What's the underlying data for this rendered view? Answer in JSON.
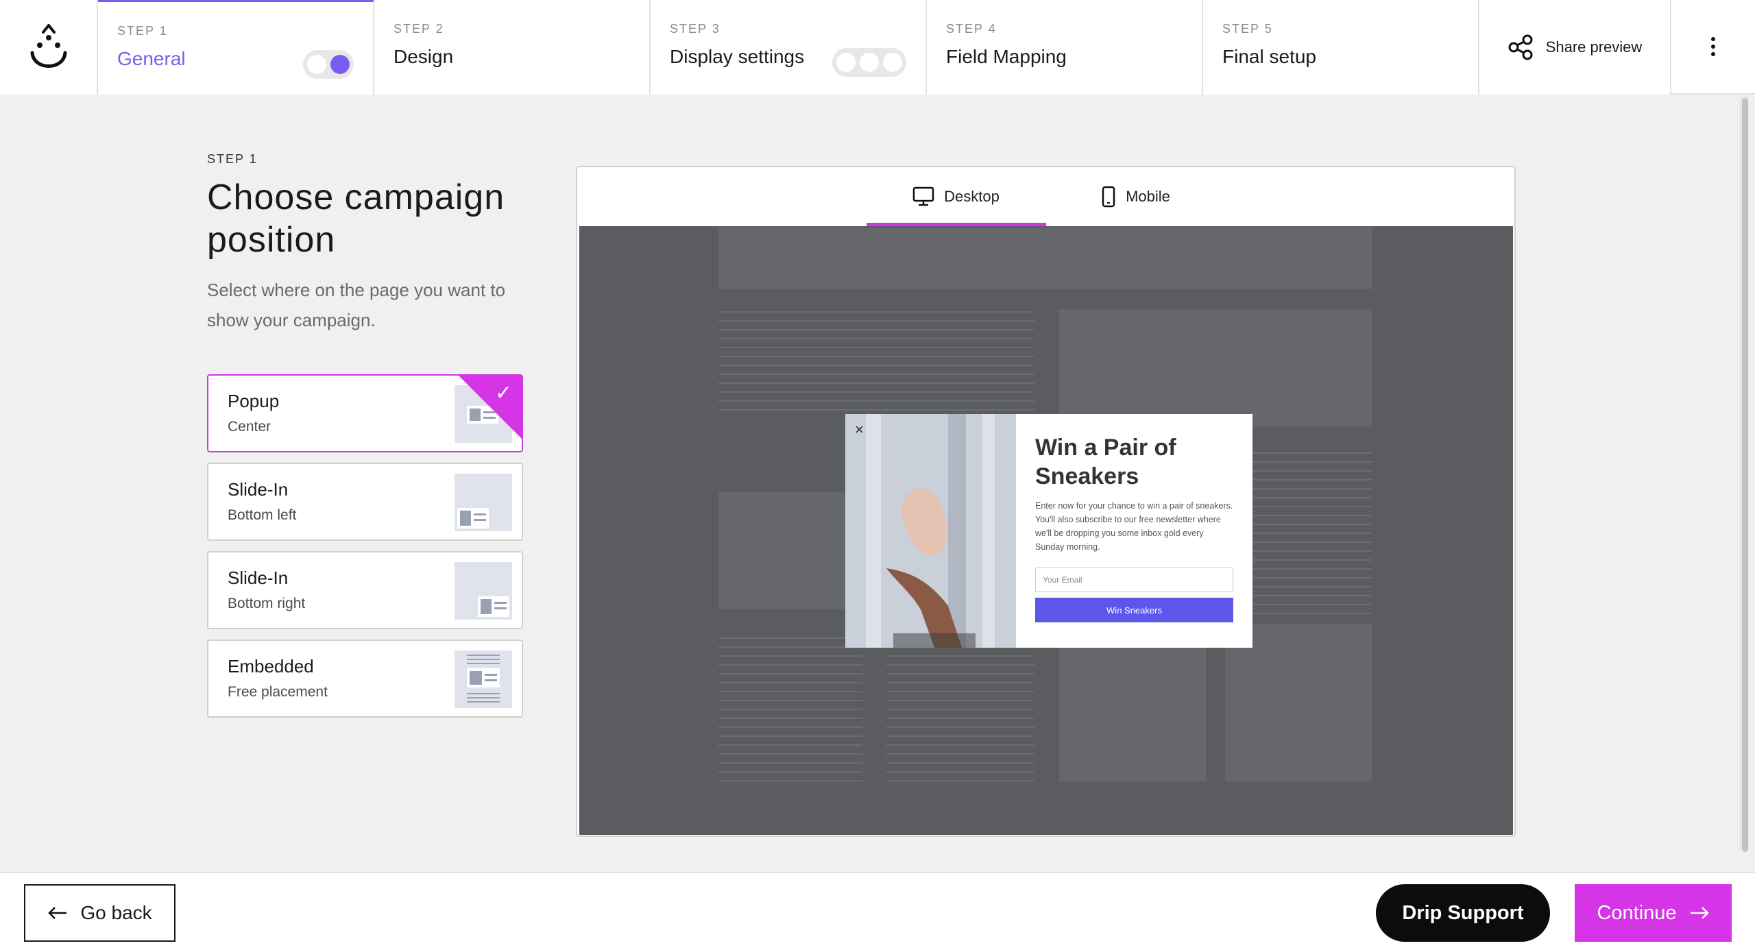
{
  "nav": {
    "logo_icon": "drip-smile-logo",
    "steps": [
      {
        "num": "STEP 1",
        "label": "General",
        "active": true
      },
      {
        "num": "STEP 2",
        "label": "Design"
      },
      {
        "num": "STEP 3",
        "label": "Display settings"
      },
      {
        "num": "STEP 4",
        "label": "Field Mapping"
      },
      {
        "num": "STEP 5",
        "label": "Final setup"
      }
    ],
    "share_label": "Share preview",
    "share_icon": "share-icon",
    "more_icon": "vertical-dots-icon",
    "accent": "#7b5cf0"
  },
  "left": {
    "eyebrow": "STEP 1",
    "title": "Choose campaign position",
    "subtitle": "Select where on the page you want to show your campaign.",
    "options": [
      {
        "title": "Popup",
        "sub": "Center",
        "selected": true
      },
      {
        "title": "Slide-In",
        "sub": "Bottom left"
      },
      {
        "title": "Slide-In",
        "sub": "Bottom right"
      },
      {
        "title": "Embedded",
        "sub": "Free placement"
      }
    ],
    "check": "✓"
  },
  "preview": {
    "tabs": [
      {
        "label": "Desktop",
        "icon": "monitor-icon",
        "active": true
      },
      {
        "label": "Mobile",
        "icon": "phone-icon"
      }
    ],
    "popup": {
      "close": "×",
      "title": "Win a Pair of Sneakers",
      "text": "Enter now for your chance to win a pair of sneakers. You'll also subscribe to our free newsletter where we'll be dropping you some inbox gold every Sunday morning.",
      "input_placeholder": "Your Email",
      "button": "Win Sneakers"
    }
  },
  "footer": {
    "back": "Go back",
    "support": "Drip Support",
    "continue": "Continue"
  },
  "colors": {
    "magenta": "#d535e6",
    "purple": "#7b5cf0",
    "button_blue": "#5b57ea"
  }
}
